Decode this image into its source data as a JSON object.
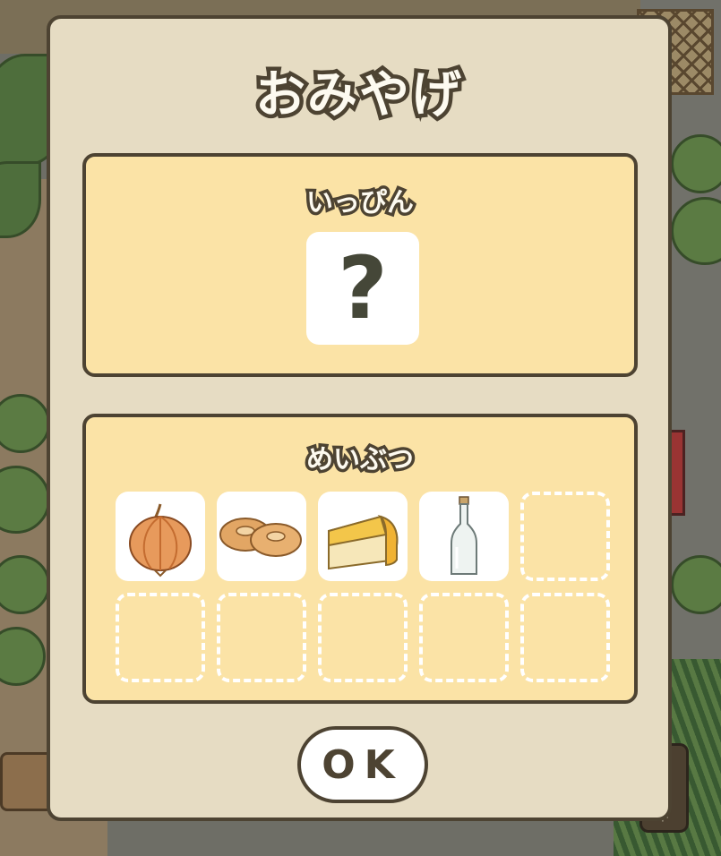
{
  "dialog": {
    "title": "おみやげ",
    "specialty": {
      "label": "いっぴん",
      "item_symbol": "?"
    },
    "meibutsu": {
      "label": "めいぶつ",
      "items": [
        {
          "icon": "onion-icon"
        },
        {
          "icon": "bagel-icon"
        },
        {
          "icon": "cheese-icon"
        },
        {
          "icon": "glass-bottle-icon"
        }
      ],
      "total_slots": 10
    },
    "ok_label": "OK"
  },
  "colors": {
    "outline": "#4d4332",
    "dialog_bg": "#e6dcc3",
    "panel_bg": "#fbe3a6",
    "slot_bg": "#ffffff"
  }
}
